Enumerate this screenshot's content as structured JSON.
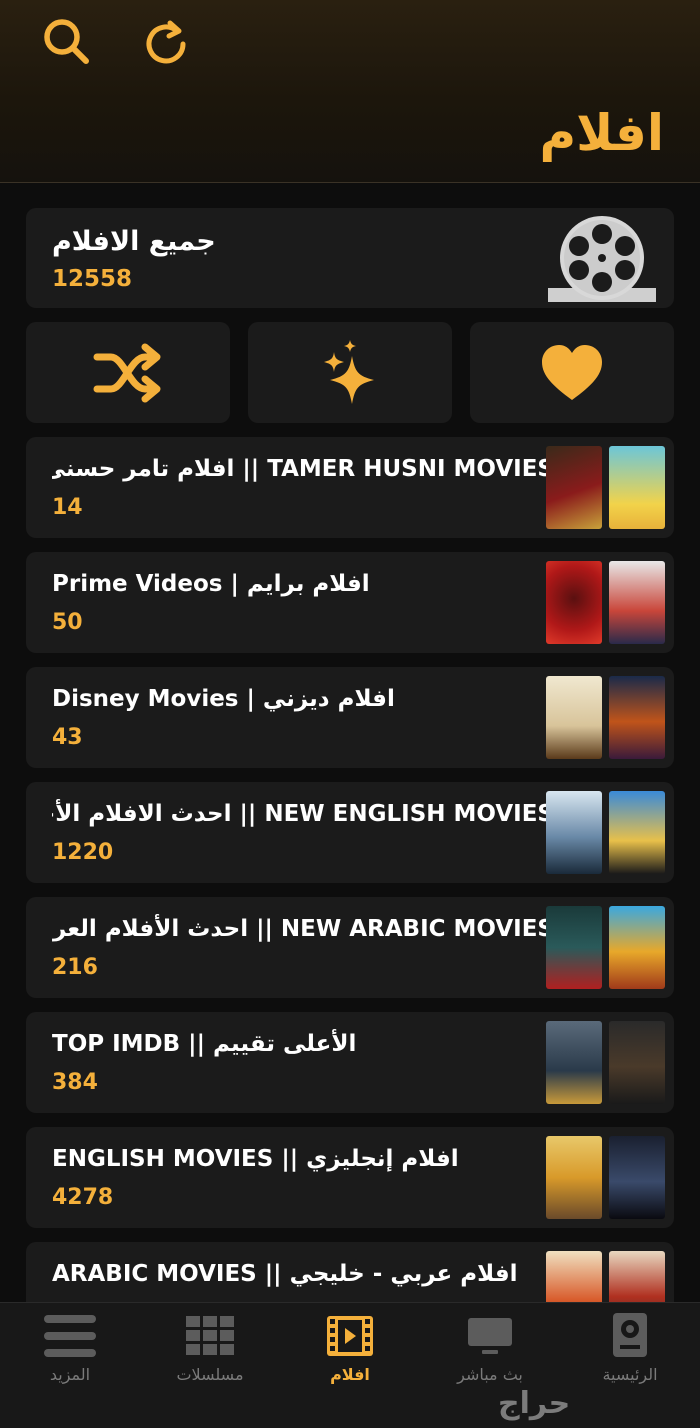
{
  "colors": {
    "accent": "#f4b03b",
    "card": "#1b1b1b",
    "background": "#0d0d0d"
  },
  "header": {
    "title": "افلام",
    "search_icon": "search-icon",
    "refresh_icon": "refresh-icon"
  },
  "all_movies": {
    "title": "جميع الافلام",
    "count": "12558",
    "icon": "film-reel-icon"
  },
  "actions": [
    {
      "icon": "shuffle-icon"
    },
    {
      "icon": "sparkles-icon"
    },
    {
      "icon": "heart-icon"
    }
  ],
  "categories": [
    {
      "title": "TAMER HUSNI MOVIES || افلام تامر حسنى",
      "count": "14"
    },
    {
      "title": "Prime Videos | افلام برايم",
      "count": "50"
    },
    {
      "title": "Disney Movies | افلام ديزني",
      "count": "43"
    },
    {
      "title": "NEW ENGLISH MOVIES || احدث الافلام الأجنبية",
      "count": "1220"
    },
    {
      "title": "NEW ARABIC MOVIES || احدث الأفلام العربية",
      "count": "216"
    },
    {
      "title": "TOP IMDB || الأعلى تقييم",
      "count": "384"
    },
    {
      "title": "ENGLISH MOVIES || افلام إنجليزي",
      "count": "4278"
    },
    {
      "title": "ARABIC MOVIES || افلام عربي - خليجي",
      "count": ""
    }
  ],
  "bottom_nav": [
    {
      "label": "المزيد",
      "icon": "menu-icon"
    },
    {
      "label": "مسلسلات",
      "icon": "grid-icon"
    },
    {
      "label": "افلام",
      "icon": "film-icon"
    },
    {
      "label": "بث مباشر",
      "icon": "tv-icon"
    },
    {
      "label": "الرئيسية",
      "icon": "home-icon"
    }
  ],
  "watermark": "حراج"
}
